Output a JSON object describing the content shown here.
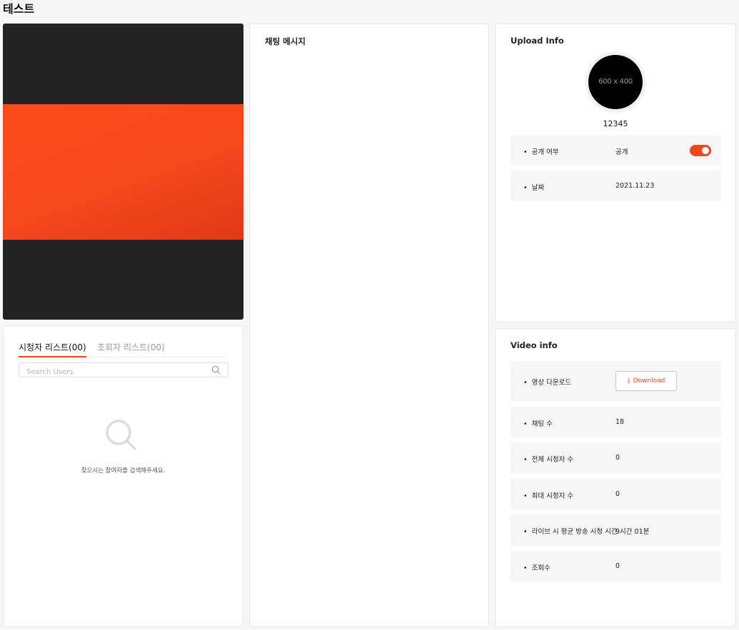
{
  "page": {
    "title": "테스트"
  },
  "viewers": {
    "tabs": [
      {
        "label": "시청자 리스트(00)",
        "active": true
      },
      {
        "label": "조회자 리스트(00)",
        "active": false
      }
    ],
    "search_placeholder": "Search Users",
    "empty_message": "찾으시는 참여자를 검색해주세요."
  },
  "chat": {
    "title": "채팅 메시지"
  },
  "upload_info": {
    "title": "Upload Info",
    "thumbnail_text": "600 x 400",
    "name": "12345",
    "rows": [
      {
        "label": "공개 여부",
        "value": "공개",
        "toggle_on": true
      },
      {
        "label": "날짜",
        "value": "2021.11.23"
      }
    ]
  },
  "video_info": {
    "title": "Video info",
    "download": {
      "label": "영상 다운로드",
      "button": "Download"
    },
    "rows": [
      {
        "label": "채팅 수",
        "value": "18"
      },
      {
        "label": "전체 시청자 수",
        "value": "0"
      },
      {
        "label": "최대 시청자 수",
        "value": "0"
      },
      {
        "label": "라이브 시 평균 방송 시청 시간",
        "value": "9시간 01분"
      },
      {
        "label": "조회수",
        "value": "0"
      }
    ]
  },
  "colors": {
    "accent": "#f0461e",
    "player_bg": "#232323",
    "video_frame": "#fc4b1b"
  }
}
